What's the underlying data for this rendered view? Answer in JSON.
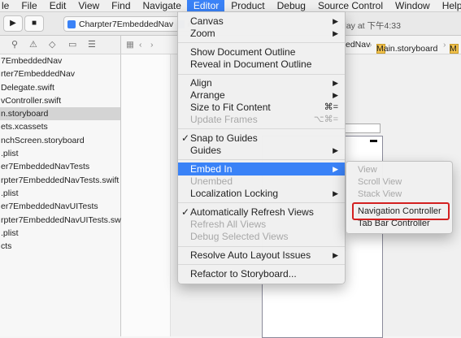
{
  "menubar": {
    "items": [
      "le",
      "File",
      "Edit",
      "View",
      "Find",
      "Navigate",
      "Editor",
      "Product",
      "Debug",
      "Source Control",
      "Window",
      "Help"
    ]
  },
  "toolbar": {
    "scheme": "Charpter7EmbeddedNav",
    "device": "iP",
    "status": "day at 下午4:33"
  },
  "jumpbar": {
    "crumb1": "edNav",
    "crumb2": "Main.storyboard",
    "crumb3": "M"
  },
  "navigator": {
    "files": [
      "7EmbeddedNav",
      "rter7EmbeddedNav",
      "Delegate.swift",
      "vController.swift",
      "n.storyboard",
      "ets.xcassets",
      "nchScreen.storyboard",
      ".plist",
      "er7EmbeddedNavTests",
      "rpter7EmbeddedNavTests.swift",
      ".plist",
      "er7EmbeddedNavUITests",
      "rpter7EmbeddedNavUITests.swift",
      ".plist",
      "cts"
    ],
    "selected_index": 4
  },
  "editor_menu": {
    "canvas": "Canvas",
    "zoom": "Zoom",
    "show_outline": "Show Document Outline",
    "reveal_outline": "Reveal in Document Outline",
    "align": "Align",
    "arrange": "Arrange",
    "size_to_fit": "Size to Fit Content",
    "size_to_fit_shortcut": "⌘=",
    "update_frames": "Update Frames",
    "update_frames_shortcut": "⌥⌘=",
    "snap_to_guides": "Snap to Guides",
    "guides": "Guides",
    "embed_in": "Embed In",
    "unembed": "Unembed",
    "localization_locking": "Localization Locking",
    "auto_refresh": "Automatically Refresh Views",
    "refresh_all": "Refresh All Views",
    "debug_selected": "Debug Selected Views",
    "resolve_layout": "Resolve Auto Layout Issues",
    "refactor": "Refactor to Storyboard...",
    "check": "✓",
    "arrow": "▶"
  },
  "embed_submenu": {
    "view": "View",
    "scroll_view": "Scroll View",
    "stack_view": "Stack View",
    "navigation_controller": "Navigation Controller",
    "tab_bar_controller": "Tab Bar Controller"
  },
  "colors": {
    "highlight": "#3a82f7",
    "annotation": "#d32020"
  }
}
